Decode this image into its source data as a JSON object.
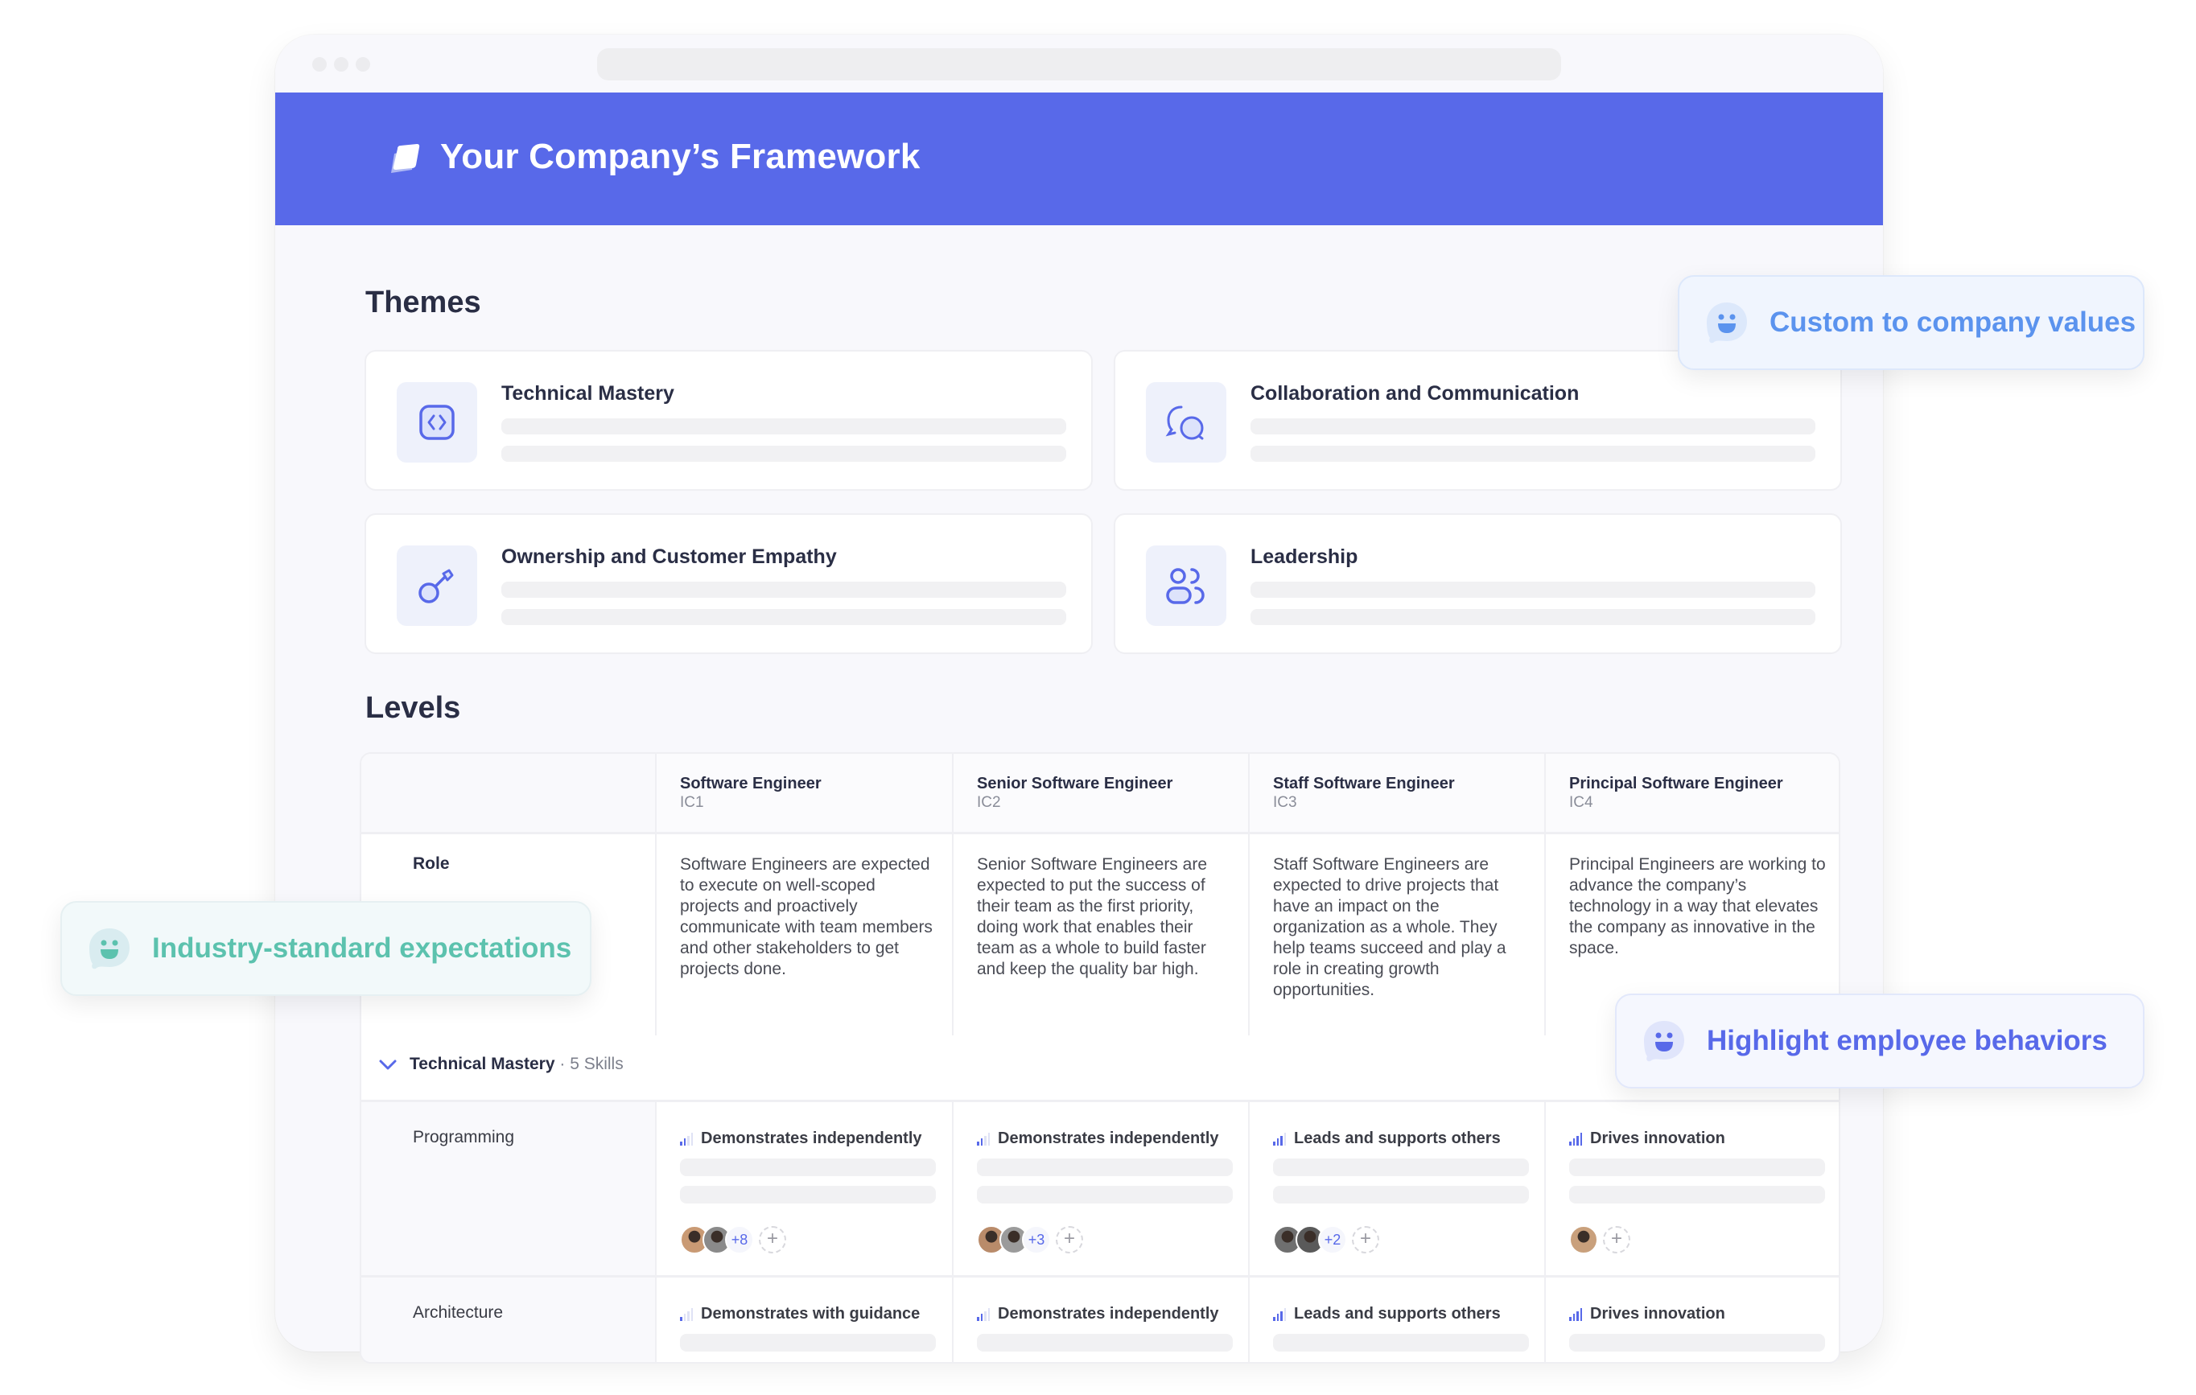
{
  "header": {
    "title": "Your Company’s Framework"
  },
  "themes": {
    "heading": "Themes",
    "items": [
      {
        "name": "Technical Mastery",
        "icon": "code-icon"
      },
      {
        "name": "Collaboration and Communication",
        "icon": "chat-bubbles-icon"
      },
      {
        "name": "Ownership and Customer Empathy",
        "icon": "key-icon"
      },
      {
        "name": "Leadership",
        "icon": "users-icon"
      }
    ]
  },
  "levels": {
    "heading": "Levels",
    "columns": [
      {
        "title": "Software Engineer",
        "code": "IC1"
      },
      {
        "title": "Senior Software Engineer",
        "code": "IC2"
      },
      {
        "title": "Staff Software Engineer",
        "code": "IC3"
      },
      {
        "title": "Principal Software Engineer",
        "code": "IC4"
      }
    ],
    "role_label": "Role",
    "roles": [
      "Software Engineers are expected to execute on well-scoped projects and proactively communicate with team members and other stakeholders to get projects done.",
      "Senior Software Engineers are expected to put the success of their team as the first priority, doing work that enables their team as a whole to build faster and keep the quality bar high.",
      "Staff Software Engineers are expected to drive projects that have an impact on the organization as a whole. They help teams succeed and play a role in creating growth opportunities.",
      "Principal Engineers are working to advance the company’s technology in a way that elevates the company as innovative in the space."
    ],
    "group": {
      "title": "Technical Mastery",
      "count": " · 5 Skills",
      "expanded": true
    },
    "skills": [
      {
        "name": "Programming",
        "cells": [
          {
            "label": "Demonstrates independently",
            "signal_level": 2,
            "signal_max": 4,
            "more": "+8",
            "avatar_count": 2
          },
          {
            "label": "Demonstrates independently",
            "signal_level": 2,
            "signal_max": 4,
            "more": "+3",
            "avatar_count": 2
          },
          {
            "label": "Leads and supports others",
            "signal_level": 3,
            "signal_max": 4,
            "more": "+2",
            "avatar_count": 2
          },
          {
            "label": "Drives innovation",
            "signal_level": 4,
            "signal_max": 4,
            "more": null,
            "avatar_count": 1
          }
        ]
      },
      {
        "name": "Architecture",
        "cells": [
          {
            "label": "Demonstrates with guidance",
            "signal_level": 1,
            "signal_max": 4
          },
          {
            "label": "Demonstrates independently",
            "signal_level": 2,
            "signal_max": 4
          },
          {
            "label": "Leads and supports others",
            "signal_level": 3,
            "signal_max": 4
          },
          {
            "label": "Drives innovation",
            "signal_level": 4,
            "signal_max": 4
          }
        ]
      }
    ],
    "add_label": "+"
  },
  "badges": [
    {
      "text": "Custom to company values",
      "color": "#5b93ee",
      "bg": "#f0f5fe"
    },
    {
      "text": "Industry-standard expectations",
      "color": "#5cc2ae",
      "bg": "#f2f9fa"
    },
    {
      "text": "Highlight employee behaviors",
      "color": "#5869e9",
      "bg": "#f5f7fe"
    }
  ],
  "colors": {
    "brand": "#5869e9"
  }
}
